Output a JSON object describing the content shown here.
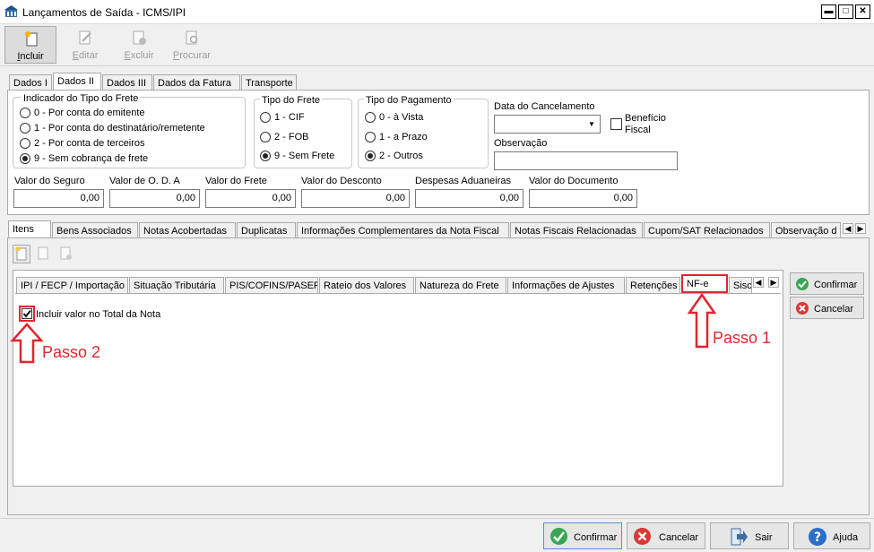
{
  "window": {
    "title": "Lançamentos de Saída - ICMS/IPI",
    "min": "▬",
    "max": "□",
    "close": "✕"
  },
  "toolbar": {
    "incluir": "Incluir",
    "editar": "Editar",
    "excluir": "Excluir",
    "procurar": "Procurar"
  },
  "tabs_top": [
    "Dados I",
    "Dados II",
    "Dados III",
    "Dados da Fatura",
    "Transporte"
  ],
  "frete_ind": {
    "title": "Indicador do Tipo do Frete",
    "options": [
      "0 - Por conta do emitente",
      "1 - Por conta do destinatário/remetente",
      "2 - Por conta de terceiros",
      "9 - Sem cobrança de frete"
    ],
    "selected": 3
  },
  "tipo_frete": {
    "title": "Tipo do Frete",
    "options": [
      "1 - CIF",
      "2 - FOB",
      "9 - Sem Frete"
    ],
    "selected": 2
  },
  "tipo_pag": {
    "title": "Tipo do Pagamento",
    "options": [
      "0 - à Vista",
      "1 - a Prazo",
      "2 - Outros"
    ],
    "selected": 2
  },
  "data_canc": {
    "label": "Data do Cancelamento",
    "value": ""
  },
  "beneficio": {
    "label1": "Benefício",
    "label2": "Fiscal"
  },
  "observacao": {
    "label": "Observação",
    "value": ""
  },
  "valores": [
    {
      "label": "Valor do Seguro",
      "value": "0,00"
    },
    {
      "label": "Valor de O. D. A",
      "value": "0,00"
    },
    {
      "label": "Valor do Frete",
      "value": "0,00"
    },
    {
      "label": "Valor do Desconto",
      "value": "0,00"
    },
    {
      "label": "Despesas Aduaneiras",
      "value": "0,00"
    },
    {
      "label": "Valor do Documento",
      "value": "0,00"
    }
  ],
  "tabs_mid": [
    "Itens",
    "Bens Associados",
    "Notas Acobertadas",
    "Duplicatas",
    "Informações Complementares da Nota Fiscal",
    "Notas Fiscais Relacionadas",
    "Cupom/SAT Relacionados",
    "Observação d"
  ],
  "tabs_inner": [
    "IPI / FECP / Importação",
    "Situação Tributária",
    "PIS/COFINS/PASEP",
    "Rateio dos Valores",
    "Natureza do Frete",
    "Informações de Ajustes",
    "Retenções",
    "NF-e",
    "Sisco"
  ],
  "nfe": {
    "checkbox_label": "Incluir valor no Total da Nota",
    "checked": true
  },
  "annotations": {
    "passo1": "Passo 1",
    "passo2": "Passo 2"
  },
  "side_buttons": {
    "confirmar": "Confirmar",
    "cancelar": "Cancelar"
  },
  "bottom_buttons": {
    "confirmar": "Confirmar",
    "cancelar": "Cancelar",
    "sair": "Sair",
    "ajuda": "Ajuda"
  },
  "arrows": {
    "left": "◀",
    "right": "▶"
  }
}
